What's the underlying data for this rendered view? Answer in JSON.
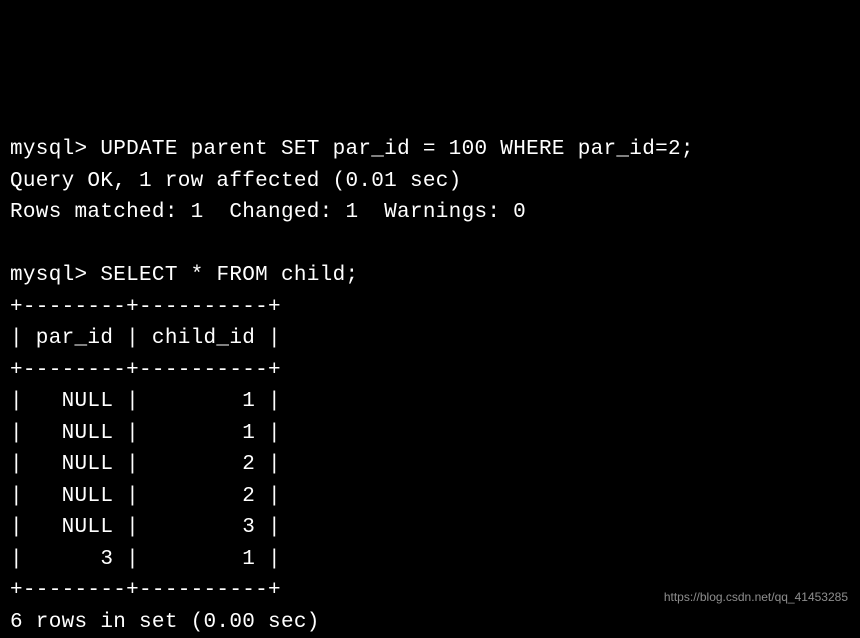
{
  "prompt": "mysql>",
  "commands": {
    "update": "UPDATE parent SET par_id = 100 WHERE par_id=2;",
    "select": "SELECT * FROM child;"
  },
  "responses": {
    "query_ok": "Query OK, 1 row affected (0.01 sec)",
    "rows_info": "Rows matched: 1  Changed: 1  Warnings: 0",
    "rows_in_set": "6 rows in set (0.00 sec)"
  },
  "table": {
    "border_top": "+--------+----------+",
    "header": "| par_id | child_id |",
    "border_mid": "+--------+----------+",
    "rows": [
      "|   NULL |        1 |",
      "|   NULL |        1 |",
      "|   NULL |        2 |",
      "|   NULL |        2 |",
      "|   NULL |        3 |",
      "|      3 |        1 |"
    ],
    "border_bottom": "+--------+----------+"
  },
  "watermark": "https://blog.csdn.net/qq_41453285"
}
